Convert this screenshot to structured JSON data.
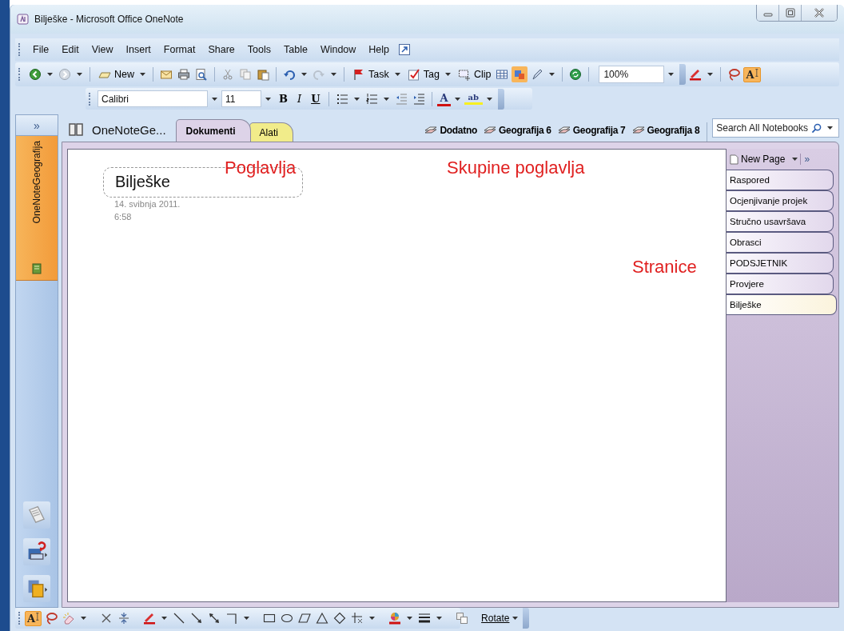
{
  "window": {
    "title": "Bilješke - Microsoft Office OneNote"
  },
  "menu": [
    "File",
    "Edit",
    "View",
    "Insert",
    "Format",
    "Share",
    "Tools",
    "Table",
    "Window",
    "Help"
  ],
  "toolbar": {
    "new": "New",
    "task": "Task",
    "tag": "Tag",
    "clip": "Clip",
    "zoom": "100%",
    "text_tool": "A"
  },
  "format_bar": {
    "font": "Calibri",
    "size": "11",
    "bold": "B",
    "italic": "I",
    "underline": "U",
    "font_color": "A",
    "highlight": "ab"
  },
  "notebook_pane": {
    "expand": "»",
    "notebook": "OneNoteGeografija"
  },
  "notebook_title": "OneNoteGe...",
  "sections": [
    {
      "label": "Dokumenti",
      "selected": true,
      "color": "#ddd3e8"
    },
    {
      "label": "Alati",
      "selected": false,
      "color": "#f1ec8a"
    }
  ],
  "section_groups": [
    "Dodatno",
    "Geografija 6",
    "Geografija 7",
    "Geografija 8"
  ],
  "search": {
    "placeholder": "Search All Notebooks"
  },
  "page": {
    "title": "Bilješke",
    "date": "14. svibnja 2011.",
    "time": "6:58"
  },
  "annotations": [
    "Poglavlja",
    "Skupine poglavlja",
    "Stranice"
  ],
  "page_list": {
    "new_page": "New Page",
    "more": "»",
    "pages": [
      {
        "label": "Raspored",
        "selected": false
      },
      {
        "label": "Ocjenjivanje projek",
        "selected": false
      },
      {
        "label": "Stručno usavršava",
        "selected": false
      },
      {
        "label": "Obrasci",
        "selected": false
      },
      {
        "label": "PODSJETNIK",
        "selected": false
      },
      {
        "label": "Provjere",
        "selected": false
      },
      {
        "label": "Bilješke",
        "selected": true
      }
    ]
  },
  "drawing_toolbar": {
    "text_tool": "A",
    "rotate": "Rotate"
  }
}
